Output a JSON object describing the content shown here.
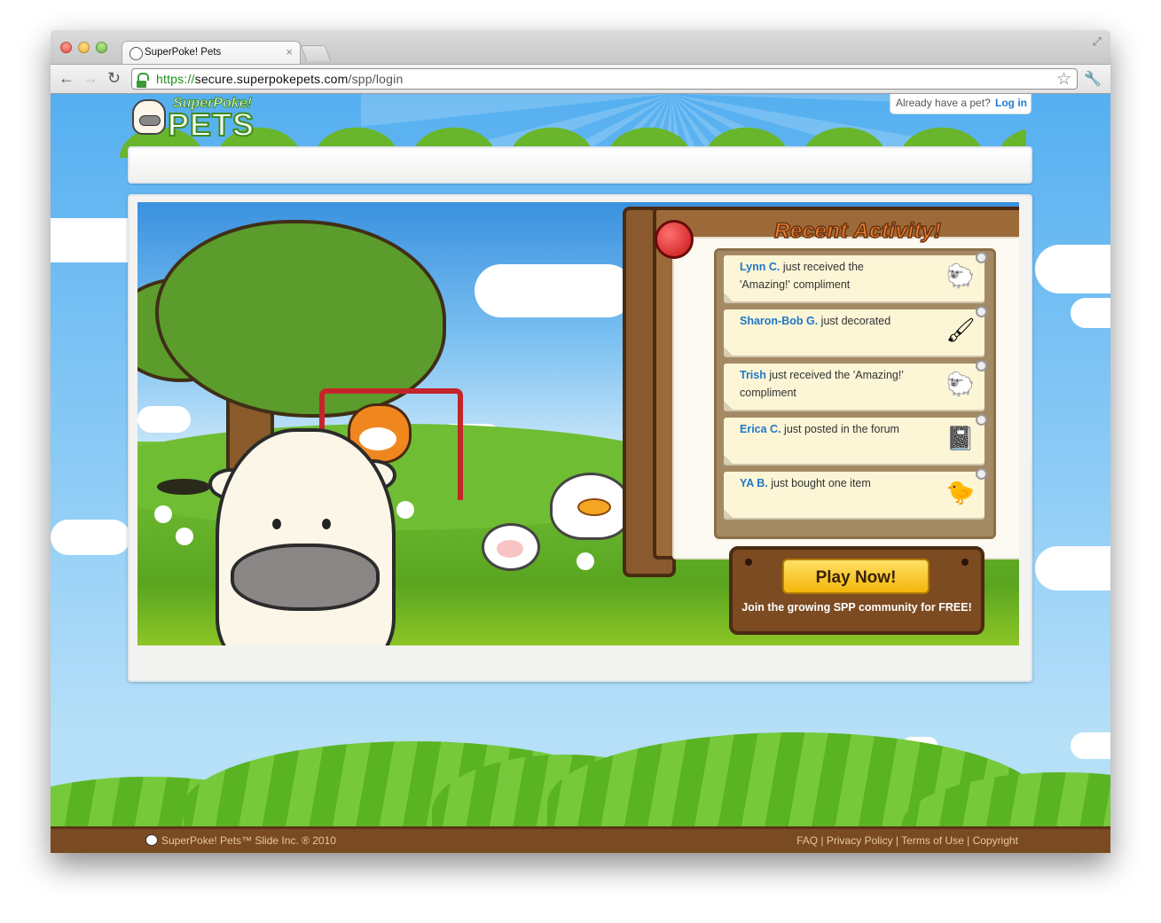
{
  "browser": {
    "tab_title": "SuperPoke! Pets",
    "tab_close": "×",
    "url_scheme": "https://",
    "url_host": "secure.superpokepets.com",
    "url_path": "/spp/login",
    "back_glyph": "←",
    "forward_glyph": "→",
    "reload_glyph": "↻",
    "star_glyph": "☆",
    "wrench_glyph": "🔧",
    "resize_glyph": "⤢"
  },
  "header": {
    "logo_top": "SuperPoke!",
    "logo_bottom": "PETS",
    "login_prompt": "Already have a pet?",
    "login_link": "Log in"
  },
  "activity": {
    "title": "Recent Activity!",
    "items": [
      {
        "name": "Lynn C.",
        "text": " just received the 'Amazing!' compliment",
        "thumb": "sheep-icon"
      },
      {
        "name": "Sharon-Bob G.",
        "text": " just decorated",
        "thumb": "paint-brushes-icon"
      },
      {
        "name": "Trish",
        "text": " just received the 'Amazing!' compliment",
        "thumb": "sheep-icon"
      },
      {
        "name": "Erica C.",
        "text": " just posted in the forum",
        "thumb": "notebook-pencil-icon"
      },
      {
        "name": "YA B.",
        "text": " just bought one item",
        "thumb": "chick-icon"
      }
    ]
  },
  "cta": {
    "button": "Play Now!",
    "tagline": "Join the growing SPP community for FREE!"
  },
  "footer": {
    "copyright": "SuperPoke! Pets™ Slide Inc. ® 2010",
    "links": [
      "FAQ",
      "Privacy Policy",
      "Terms of Use",
      "Copyright"
    ],
    "separator": " | "
  },
  "colors": {
    "link_blue": "#1f78c8",
    "button_yellow": "#f3b609",
    "footer_brown": "#7a4a22"
  }
}
